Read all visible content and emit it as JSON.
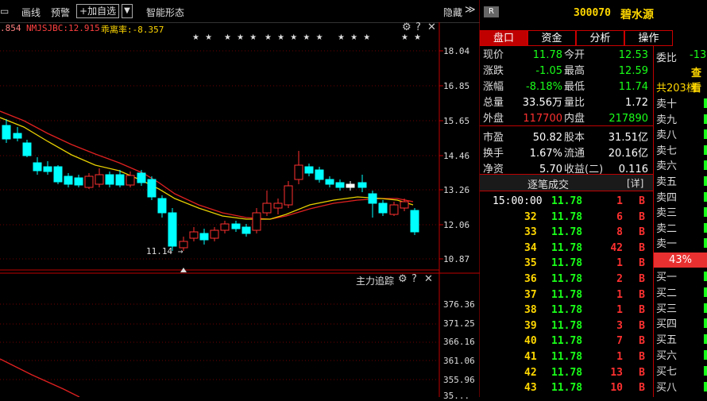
{
  "toolbar": {
    "items": [
      "画线",
      "预警"
    ],
    "add_select": "加自选",
    "dropdown": "▼",
    "smart_shape": "智能形态",
    "hide": "隐藏",
    "hide_arrow": "≫"
  },
  "indicator_line": {
    "ma1": ".854",
    "ma2": "NMJSJBC:12.915",
    "bias_label": "乖离率:-8.357",
    "stars_groups": [
      "★ ★",
      "★ ★ ★",
      "★ ★ ★ ★ ★",
      "★ ★ ★",
      "★ ★"
    ]
  },
  "main_chart": {
    "price_labels": [
      "18.04",
      "16.85",
      "15.65",
      "14.46",
      "13.26",
      "12.06",
      "10.87"
    ],
    "low_marker": "11.14",
    "ctrl_icons": [
      "gear-icon",
      "help-icon",
      "close-icon"
    ]
  },
  "sub_chart": {
    "title": "主力追踪",
    "labels": [
      "376.36",
      "371.25",
      "366.16",
      "361.06",
      "355.96"
    ],
    "bottom_partial": "35..."
  },
  "stock": {
    "badge": "R",
    "code": "300070",
    "name": "碧水源"
  },
  "tabs": [
    "盘口",
    "资金",
    "分析",
    "操作"
  ],
  "quote": [
    {
      "l1": "现价",
      "v1": "11.78",
      "c1": "grn",
      "l2": "今开",
      "v2": "12.53",
      "c2": "grn"
    },
    {
      "l1": "涨跌",
      "v1": "-1.05",
      "c1": "grn",
      "l2": "最高",
      "v2": "12.59",
      "c2": "grn"
    },
    {
      "l1": "涨幅",
      "v1": "-8.18%",
      "c1": "grn",
      "l2": "最低",
      "v2": "11.74",
      "c2": "grn"
    },
    {
      "l1": "总量",
      "v1": "33.56万",
      "c1": "wht",
      "l2": "量比",
      "v2": "1.72",
      "c2": "wht"
    },
    {
      "l1": "外盘",
      "v1": "117700",
      "c1": "red",
      "l2": "内盘",
      "v2": "217890",
      "c2": "grn"
    },
    {
      "l1": "市盈",
      "v1": "50.82",
      "c1": "wht",
      "l2": "股本",
      "v2": "31.51亿",
      "c2": "wht"
    },
    {
      "l1": "换手",
      "v1": "1.67%",
      "c1": "wht",
      "l2": "流通",
      "v2": "20.16亿",
      "c2": "wht"
    },
    {
      "l1": "净资",
      "v1": "5.70",
      "c1": "wht",
      "l2": "收益(二)",
      "v2": "0.116",
      "c2": "wht"
    }
  ],
  "trades": {
    "title": "逐笔成交",
    "detail": "[详]",
    "first_time": "15:00:00",
    "rows": [
      {
        "n": "",
        "p": "11.78",
        "v": "1",
        "f": "B"
      },
      {
        "n": "32",
        "p": "11.78",
        "v": "6",
        "f": "B"
      },
      {
        "n": "33",
        "p": "11.78",
        "v": "8",
        "f": "B"
      },
      {
        "n": "34",
        "p": "11.78",
        "v": "42",
        "f": "B"
      },
      {
        "n": "35",
        "p": "11.78",
        "v": "1",
        "f": "B"
      },
      {
        "n": "36",
        "p": "11.78",
        "v": "2",
        "f": "B"
      },
      {
        "n": "37",
        "p": "11.78",
        "v": "1",
        "f": "B"
      },
      {
        "n": "38",
        "p": "11.78",
        "v": "1",
        "f": "B"
      },
      {
        "n": "39",
        "p": "11.78",
        "v": "3",
        "f": "B"
      },
      {
        "n": "40",
        "p": "11.78",
        "v": "7",
        "f": "B"
      },
      {
        "n": "41",
        "p": "11.78",
        "v": "1",
        "f": "B"
      },
      {
        "n": "42",
        "p": "11.78",
        "v": "13",
        "f": "B"
      },
      {
        "n": "43",
        "p": "11.78",
        "v": "10",
        "f": "B"
      }
    ]
  },
  "orderbook": {
    "weibi": "委比",
    "weibi_val": "-13",
    "query": "查看",
    "total": "共203档",
    "sells": [
      "卖十",
      "卖九",
      "卖八",
      "卖七",
      "卖六",
      "卖五",
      "卖四",
      "卖三",
      "卖二",
      "卖一"
    ],
    "ratio": "43%",
    "buys": [
      "买一",
      "买二",
      "买三",
      "买四",
      "买五",
      "买六",
      "买七",
      "买八"
    ]
  },
  "colors": {
    "up": "#ff3030",
    "down": "#00ffff",
    "ma_yellow": "#e8d000",
    "ma_red": "#e02020",
    "panel_tab": "#c00000"
  }
}
